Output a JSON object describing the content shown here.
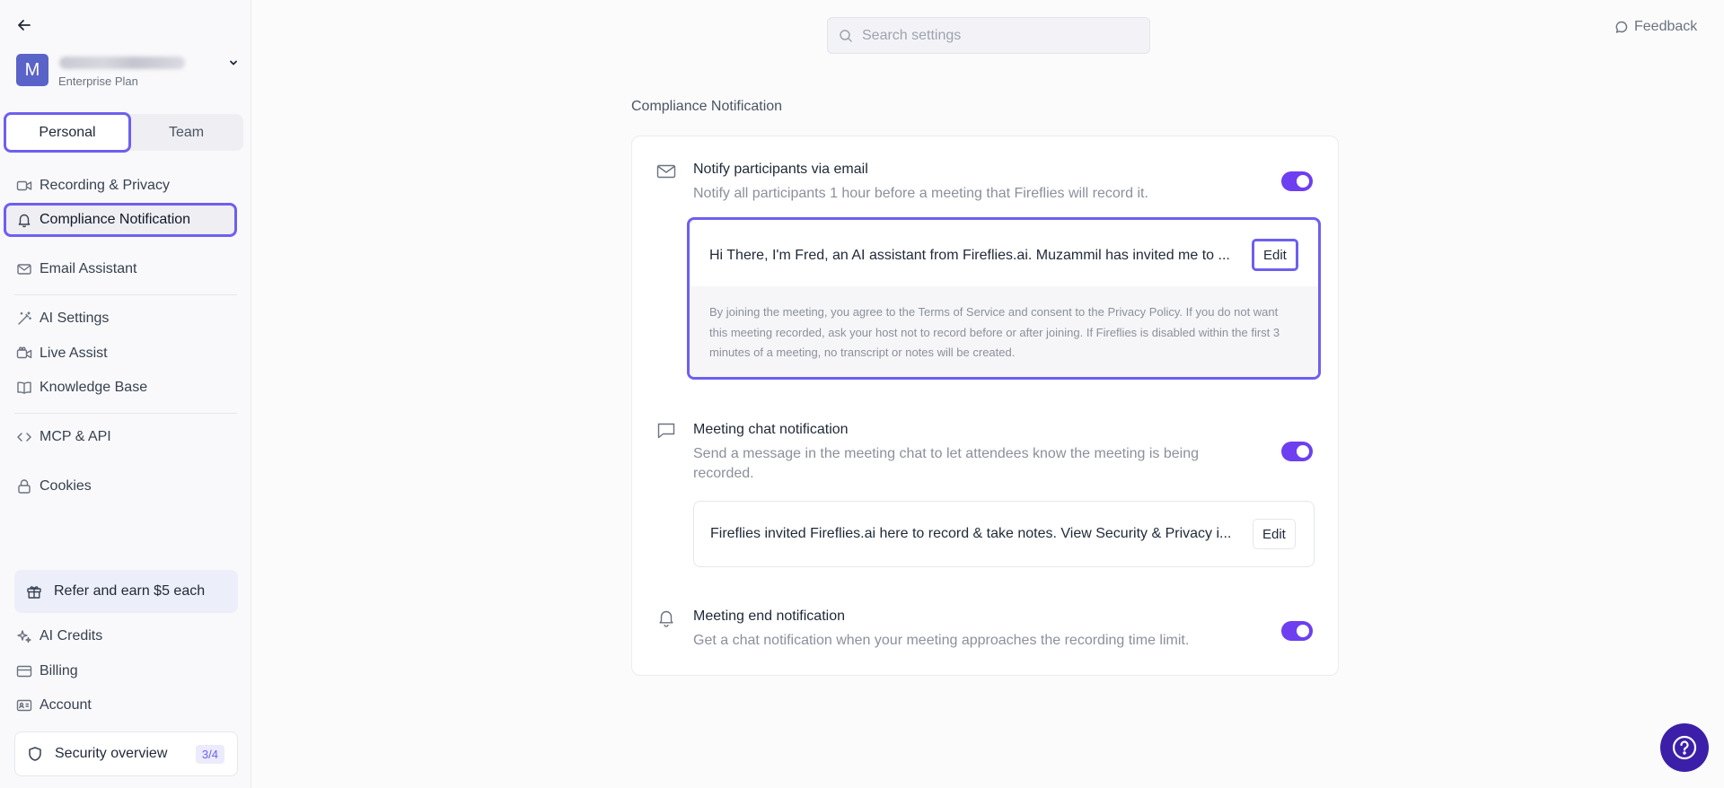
{
  "sidebar": {
    "avatar_letter": "M",
    "plan": "Enterprise Plan",
    "tabs": {
      "personal": "Personal",
      "team": "Team"
    },
    "items": [
      {
        "label": "Recording & Privacy",
        "icon": "video-icon"
      },
      {
        "label": "Compliance Notification",
        "icon": "bell-icon"
      },
      {
        "label": "Email Assistant",
        "icon": "mail-icon"
      },
      {
        "label": "AI Settings",
        "icon": "magic-wand-icon"
      },
      {
        "label": "Live Assist",
        "icon": "video-assist-icon"
      },
      {
        "label": "Knowledge Base",
        "icon": "book-icon"
      },
      {
        "label": "MCP & API",
        "icon": "code-icon"
      },
      {
        "label": "Cookies",
        "icon": "lock-icon"
      }
    ],
    "refer": "Refer and earn $5 each",
    "bottom_items": [
      {
        "label": "AI Credits",
        "icon": "sparkle-icon"
      },
      {
        "label": "Billing",
        "icon": "credit-card-icon"
      },
      {
        "label": "Account",
        "icon": "id-card-icon"
      }
    ],
    "security": {
      "label": "Security overview",
      "badge": "3/4"
    }
  },
  "topbar": {
    "search_placeholder": "Search settings",
    "feedback": "Feedback"
  },
  "main": {
    "section_title": "Compliance Notification",
    "email": {
      "title": "Notify participants via email",
      "desc": "Notify all participants 1 hour before a meeting that Fireflies will record it.",
      "enabled": true,
      "message": "Hi There, I'm Fred, an AI assistant from Fireflies.ai. Muzammil has invited me to ...",
      "edit": "Edit",
      "disclaimer": "By joining the meeting, you agree to the Terms of Service and consent to the Privacy Policy. If you do not want this meeting recorded, ask your host not to record before or after joining. If Fireflies is disabled within the first 3 minutes of a meeting, no transcript or notes will be created."
    },
    "chat": {
      "title": "Meeting chat notification",
      "desc": "Send a message in the meeting chat to let attendees know the meeting is being recorded.",
      "enabled": true,
      "message": "Fireflies invited Fireflies.ai here to record & take notes. View Security & Privacy i...",
      "edit": "Edit"
    },
    "end": {
      "title": "Meeting end notification",
      "desc": "Get a chat notification when your meeting approaches the recording time limit.",
      "enabled": true
    }
  },
  "colors": {
    "accent": "#6d3ff0",
    "highlight": "#6d5ff0",
    "help": "#3c1fa8"
  }
}
